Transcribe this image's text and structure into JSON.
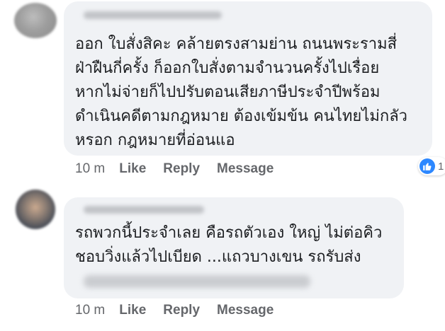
{
  "comments": [
    {
      "text_lines": [
        "ออก ใบสั่งสิคะ คล้ายตรงสามย่าน ถนนพระรามสี่",
        "ฝ่าฝืนกี่ครั้ง ก็ออกใบสั่งตามจำนวนครั้งไปเรื่อย",
        "หากไม่จ่ายก็ไปปรับตอนเสียภาษีประจำปีพร้อม",
        "ดำเนินคดีตามกฎหมาย ต้องเข้มข้น คนไทยไม่กลัว",
        "หรอก กฎหมายที่อ่อนแอ"
      ],
      "time": "10 m",
      "actions": [
        "Like",
        "Reply",
        "Message"
      ],
      "reaction_count": "1"
    },
    {
      "text_lines": [
        "รถพวกนี้ประจำเลย คือรถตัวเอง ใหญ่ ไม่ต่อคิว",
        "ชอบวิ่งแล้วไปเบียด ...แถวบางเขน รถรับส่ง"
      ],
      "time": "10 m",
      "actions": [
        "Like",
        "Reply",
        "Message"
      ]
    }
  ],
  "colors": {
    "bubble_bg": "#f0f2f5",
    "action_text": "#65676b",
    "like_blue": "#2d88ff"
  },
  "icons": {
    "reaction": "thumbs-up-icon"
  }
}
